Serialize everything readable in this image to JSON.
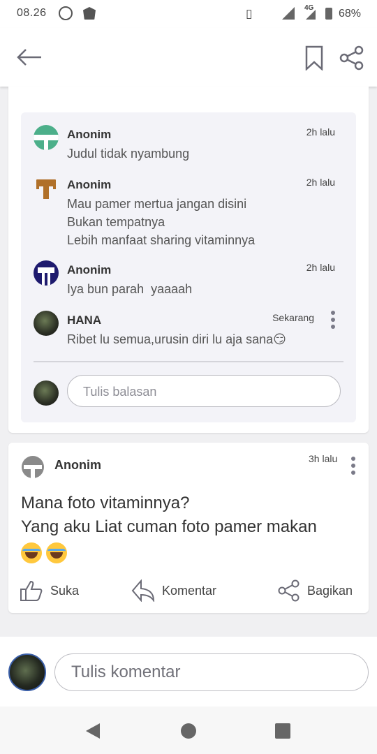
{
  "status_bar": {
    "time": "08.26",
    "battery": "68%",
    "network": "4G"
  },
  "app_bar": {
    "back_icon": "arrow-left-icon",
    "bookmark_icon": "bookmark-icon",
    "share_icon": "share-icon"
  },
  "replies": [
    {
      "name": "Anonim",
      "time": "2h lalu",
      "text": "Judul tidak nyambung",
      "avatar_color": "#4caf8a"
    },
    {
      "name": "Anonim",
      "time": "2h lalu",
      "text": "Mau pamer mertua jangan disini\nBukan tempatnya\nLebih manfaat sharing vitaminnya",
      "avatar_color": "#b0702a"
    },
    {
      "name": "Anonim",
      "time": "2h lalu",
      "text": "Iya bun parah  yaaaah",
      "avatar_color": "#1e1a6e"
    },
    {
      "name": "HANA",
      "time": "Sekarang",
      "text": "Ribet lu semua,urusin diri lu aja sana😏"
    }
  ],
  "reply_input": {
    "placeholder": "Tulis balasan"
  },
  "post": {
    "name": "Anonim",
    "time": "3h lalu",
    "line1": "Mana foto vitaminnya?",
    "line2": "Yang aku Liat cuman foto pamer makan",
    "actions": {
      "like": "Suka",
      "comment": "Komentar",
      "share": "Bagikan"
    }
  },
  "comment_input": {
    "placeholder": "Tulis komentar"
  },
  "colors": {
    "accent": "#7a7a88",
    "reply_bg": "#f3f3f8"
  }
}
